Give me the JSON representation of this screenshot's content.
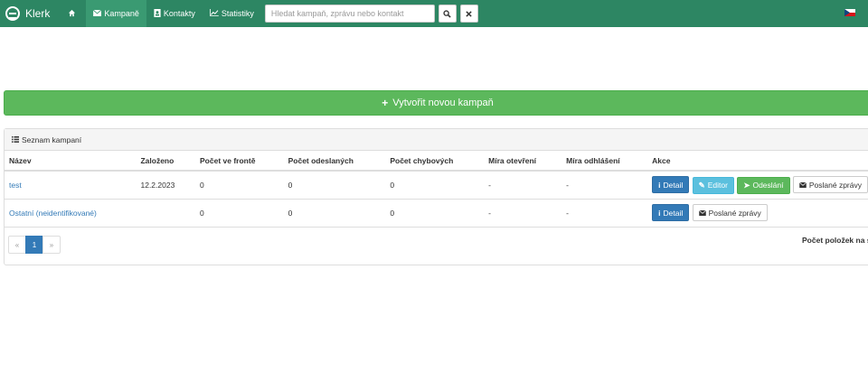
{
  "navbar": {
    "brand": "Klerk",
    "items": [
      {
        "label": "Kampaně",
        "icon": "envelope-icon"
      },
      {
        "label": "Kontakty",
        "icon": "address-book-icon"
      },
      {
        "label": "Statistiky",
        "icon": "line-chart-icon"
      }
    ],
    "search_placeholder": "Hledat kampaň, zprávu nebo kontakt",
    "language": "cs"
  },
  "create_button": "Vytvořit novou kampaň",
  "panel": {
    "title": "Seznam kampaní",
    "columns": [
      "Název",
      "Založeno",
      "Počet ve frontě",
      "Počet odeslaných",
      "Počet chybových",
      "Míra otevření",
      "Míra odhlášení",
      "Akce"
    ],
    "rows": [
      {
        "name": "test",
        "created": "12.2.2023",
        "queued": "0",
        "sent": "0",
        "errors": "0",
        "open_rate": "-",
        "unsub_rate": "-"
      },
      {
        "name": "Ostatní (neidentifikované)",
        "created": "",
        "queued": "0",
        "sent": "0",
        "errors": "0",
        "open_rate": "-",
        "unsub_rate": "-"
      }
    ],
    "actions": {
      "detail": "Detail",
      "editor": "Editor",
      "send": "Odeslání",
      "sent_messages": "Poslané zprávy"
    }
  },
  "pagination": {
    "prev": "«",
    "current": "1",
    "next": "»"
  },
  "per_page_label": "Počet položek na s",
  "colors": {
    "navbar": "#2d8663",
    "success": "#5cb85c",
    "primary": "#337ab7",
    "info": "#5bc0de"
  }
}
